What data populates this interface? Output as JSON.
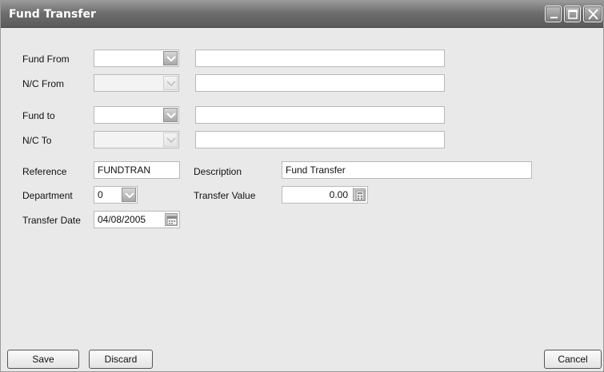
{
  "window": {
    "title": "Fund Transfer"
  },
  "form": {
    "fund_from": {
      "label": "Fund From",
      "value": "",
      "description": ""
    },
    "nc_from": {
      "label": "N/C From",
      "value": "",
      "description": ""
    },
    "fund_to": {
      "label": "Fund to",
      "value": "",
      "description": ""
    },
    "nc_to": {
      "label": "N/C To",
      "value": "",
      "description": ""
    },
    "reference": {
      "label": "Reference",
      "value": "FUNDTRAN"
    },
    "description": {
      "label": "Description",
      "value": "Fund Transfer"
    },
    "department": {
      "label": "Department",
      "value": "0"
    },
    "transfer_value": {
      "label": "Transfer Value",
      "value": "0.00"
    },
    "transfer_date": {
      "label": "Transfer Date",
      "value": "04/08/2005"
    }
  },
  "buttons": {
    "save": "Save",
    "discard": "Discard",
    "cancel": "Cancel"
  },
  "icons": {
    "minimize": "minimize-icon",
    "maximize": "maximize-icon",
    "close": "close-icon",
    "dropdown": "chevron-down-icon",
    "calculator": "calculator-icon",
    "calendar": "calendar-icon"
  },
  "colors": {
    "titlebar": "#6e6e6e",
    "background": "#e9e9e9",
    "field": "#ffffff"
  }
}
